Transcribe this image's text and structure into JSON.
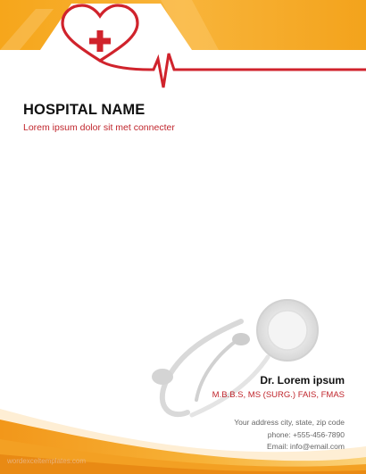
{
  "header": {
    "hospital_name": "HOSPITAL NAME",
    "tagline": "Lorem ipsum dolor sit met connecter"
  },
  "doctor": {
    "name": "Dr. Lorem ipsum",
    "degrees": "M.B.B.S, MS (SURG.) FAIS, FMAS"
  },
  "contact": {
    "address": "Your address city, state, zip code",
    "phone": "phone: +555-456-7890",
    "email": "Email:  info@email.com"
  },
  "watermark": "wordexceltemplates.com",
  "icons": [
    "heart-cross-icon",
    "heartbeat-line",
    "stethoscope-image"
  ],
  "colors": {
    "accent_orange": "#f3a31c",
    "accent_red": "#d0232c",
    "text_dark": "#111111",
    "text_gray": "#666666"
  }
}
